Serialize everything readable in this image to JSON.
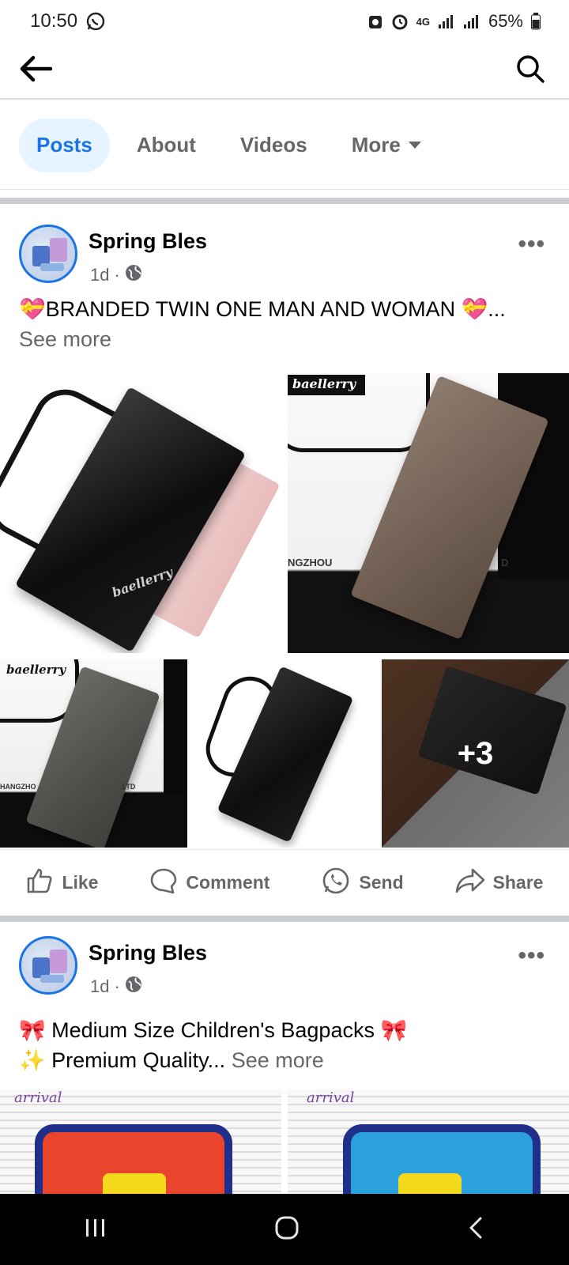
{
  "status_bar": {
    "time": "10:50",
    "network": "4G",
    "battery": "65%"
  },
  "tabs": [
    {
      "label": "Posts"
    },
    {
      "label": "About"
    },
    {
      "label": "Videos"
    },
    {
      "label": "More"
    }
  ],
  "posts": [
    {
      "author": "Spring Bles",
      "time": "1d",
      "text_line1": "💝BRANDED TWIN ONE MAN AND WOMAN 💝...",
      "see_more": "See more",
      "photo_overlay": "+3",
      "brand_marks": [
        "baellerry",
        "baellerry"
      ],
      "watermark_left": "NGZHOU",
      "watermark_right": "D",
      "watermark_small_left": "HANGZHO",
      "watermark_small_right": ".LTD"
    },
    {
      "author": "Spring Bles",
      "time": "1d",
      "text_line1": "🎀 Medium Size Children's Bagpacks 🎀",
      "text_line2": "✨ Premium Quality...",
      "see_more": "See more",
      "photo_sticker": "arrival"
    }
  ],
  "actions": {
    "like": "Like",
    "comment": "Comment",
    "send": "Send",
    "share": "Share"
  },
  "colors": {
    "accent": "#1b74e4",
    "muted": "#65676b"
  }
}
